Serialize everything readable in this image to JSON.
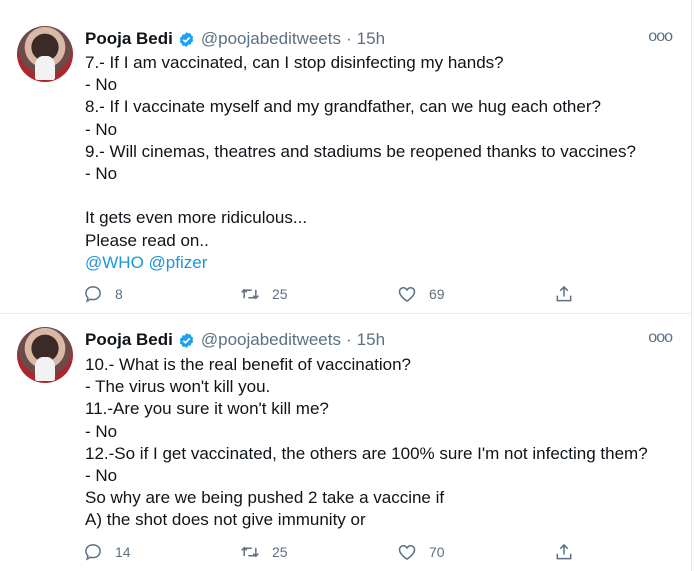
{
  "tweets": [
    {
      "author": {
        "name": "Pooja Bedi",
        "handle": "@poojabeditweets",
        "separator": "·",
        "time": "15h"
      },
      "lines": [
        "7.- If I am vaccinated, can I stop disinfecting my hands?",
        "- No",
        "8.- If I vaccinate myself and my grandfather, can we hug each other?",
        "- No",
        "9.- Will cinemas, theatres and stadiums be reopened thanks to vaccines?",
        "- No",
        "",
        "It gets even more ridiculous...",
        "Please read on.."
      ],
      "mentions": [
        "@WHO",
        "@pfizer"
      ],
      "stats": {
        "replies": "8",
        "retweets": "25",
        "likes": "69"
      }
    },
    {
      "author": {
        "name": "Pooja Bedi",
        "handle": "@poojabeditweets",
        "separator": "·",
        "time": "15h"
      },
      "lines": [
        "10.- What is the real benefit of vaccination?",
        "- The virus won't kill you.",
        "11.-Are you sure it won't kill me?",
        "- No",
        "12.-So if I get vaccinated, the others are 100% sure I'm not infecting them?",
        "- No",
        "So why are we being pushed 2 take a vaccine if",
        "A) the shot does not give immunity or"
      ],
      "stats": {
        "replies": "14",
        "retweets": "25",
        "likes": "70"
      }
    }
  ],
  "icons": {
    "more": "ooo",
    "reply": "reply-icon",
    "retweet": "retweet-icon",
    "like": "heart-icon",
    "share": "share-icon",
    "verified": "verified-badge-icon"
  },
  "colors": {
    "text": "#0f1419",
    "secondary": "#5b7083",
    "link": "#1b95e0",
    "verified": "#1da1f2"
  }
}
